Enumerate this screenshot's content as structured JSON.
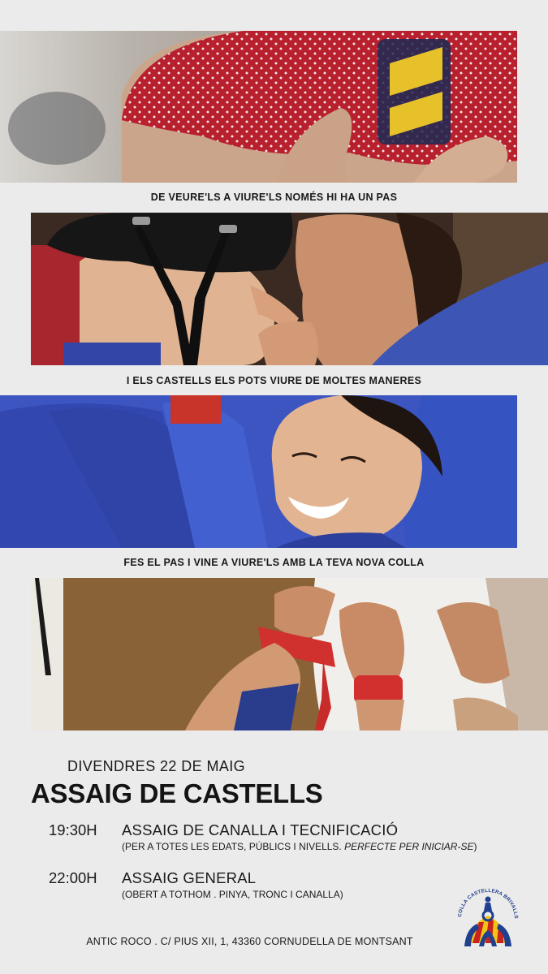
{
  "captions": [
    "DE VEURE'LS A VIURE'LS NOMÉS HI HA UN PAS",
    "I ELS CASTELLS ELS POTS VIURE DE MOLTES MANERES",
    "FES EL PAS I VINE A VIURE'LS AMB LA TEVA NOVA COLLA"
  ],
  "event": {
    "date": "DIVENDRES 22 DE MAIG",
    "title": "ASSAIG DE CASTELLS",
    "sessions": [
      {
        "time": "19:30H",
        "title": "ASSAIG DE CANALLA I TECNIFICACIÓ",
        "note": "(PER A TOTES LES EDATS, PÚBLICS I NIVELLS. ",
        "note_italic": "PERFECTE PER INICIAR-SE",
        "note_end": ")"
      },
      {
        "time": "22:00H",
        "title": "ASSAIG GENERAL",
        "note": "(OBERT A TOTHOM . PINYA, TRONC I CANALLA)"
      }
    ],
    "address": "ANTIC ROCO . C/ PIUS XII, 1, 43360 CORNUDELLA DE MONTSANT"
  },
  "logo": {
    "text": "COLLA CASTELLERA BRIVALLS DE CORNUDELLA",
    "colors": {
      "blue": "#1f3f8f",
      "red": "#c8231e",
      "yellow": "#f2c417"
    }
  },
  "photos": [
    {
      "subject": "red polka-dot headscarf being tied"
    },
    {
      "subject": "woman pointing at child wearing black helmet"
    },
    {
      "subject": "smiling girl among people in blue shirts"
    },
    {
      "subject": "hands gripping white shirt and red sashes"
    }
  ]
}
